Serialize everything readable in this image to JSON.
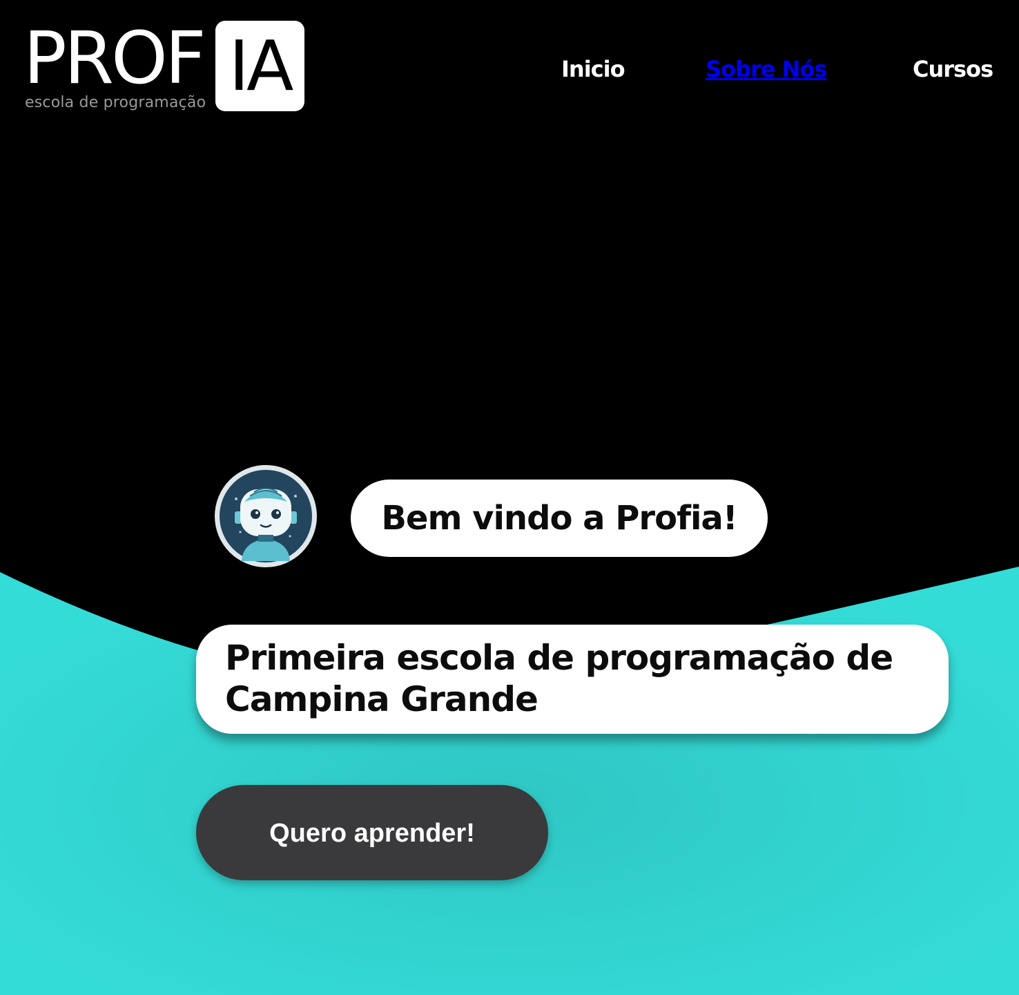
{
  "logo": {
    "prof": "PROF",
    "ia": "IA",
    "tagline": "escola de programação"
  },
  "nav": {
    "items": [
      {
        "label": "Inicio",
        "active": false
      },
      {
        "label": "Sobre Nós",
        "active": true
      },
      {
        "label": "Cursos",
        "active": false
      }
    ]
  },
  "hero": {
    "avatar_icon": "robot-avatar-icon",
    "welcome": "Bem vindo a Profia!",
    "tagline": "Primeira escola de programação de\nCampina Grande",
    "cta_label": "Quero aprender!"
  },
  "colors": {
    "background": "#000000",
    "accent_teal": "#33dcd8",
    "cta_bg": "#3a3a3c",
    "link_active": "#0000ee"
  }
}
